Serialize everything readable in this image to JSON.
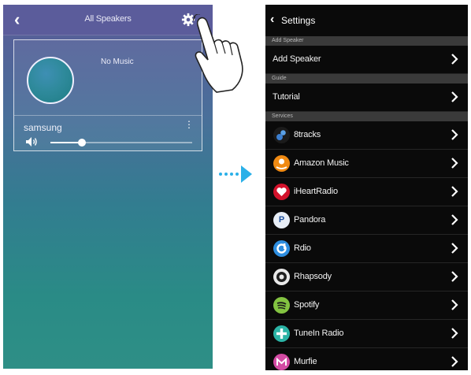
{
  "left_screen": {
    "title": "All Speakers",
    "now_playing": "No Music",
    "speaker_name": "samsung",
    "volume": 0.22
  },
  "right_screen": {
    "title": "Settings",
    "sections": [
      {
        "header": "Add Speaker",
        "rows": [
          {
            "label": "Add Speaker"
          }
        ]
      },
      {
        "header": "Guide",
        "rows": [
          {
            "label": "Tutorial"
          }
        ]
      },
      {
        "header": "Services",
        "rows": [
          {
            "label": "8tracks",
            "icon": "8tracks-icon",
            "color": "#1b1b1b"
          },
          {
            "label": "Amazon Music",
            "icon": "amazon-music-icon",
            "color": "#f08a12"
          },
          {
            "label": "iHeartRadio",
            "icon": "iheartradio-icon",
            "color": "#d3122b"
          },
          {
            "label": "Pandora",
            "icon": "pandora-icon",
            "color": "#e8eef6"
          },
          {
            "label": "Rdio",
            "icon": "rdio-icon",
            "color": "#2e8ee0"
          },
          {
            "label": "Rhapsody",
            "icon": "rhapsody-icon",
            "color": "#e9e9e9"
          },
          {
            "label": "Spotify",
            "icon": "spotify-icon",
            "color": "#83c341"
          },
          {
            "label": "TuneIn Radio",
            "icon": "tunein-radio-icon",
            "color": "#2bb4a6"
          },
          {
            "label": "Murfie",
            "icon": "murfie-icon",
            "color": "#d34aa3"
          }
        ]
      }
    ]
  }
}
